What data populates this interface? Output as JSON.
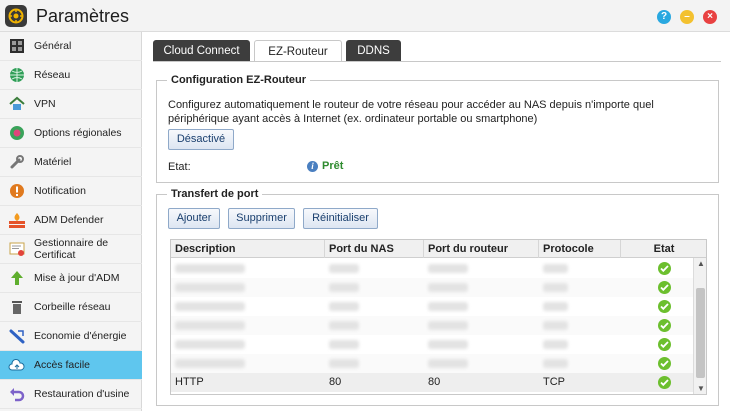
{
  "window": {
    "title": "Paramètres",
    "buttons": {
      "help": "?",
      "minimize": "–",
      "close": "×"
    }
  },
  "sidebar": {
    "items": [
      {
        "label": "Général",
        "icon": "grid-icon",
        "active": false
      },
      {
        "label": "Réseau",
        "icon": "globe-icon",
        "active": false
      },
      {
        "label": "VPN",
        "icon": "vpn-house-icon",
        "active": false
      },
      {
        "label": "Options régionales",
        "icon": "regional-clock-icon",
        "active": false
      },
      {
        "label": "Matériel",
        "icon": "wrench-icon",
        "active": false
      },
      {
        "label": "Notification",
        "icon": "alert-icon",
        "active": false
      },
      {
        "label": "ADM Defender",
        "icon": "firewall-icon",
        "active": false
      },
      {
        "label": "Gestionnaire de Certificat",
        "icon": "certificate-icon",
        "active": false
      },
      {
        "label": "Mise à jour d'ADM",
        "icon": "update-arrow-icon",
        "active": false
      },
      {
        "label": "Corbeille réseau",
        "icon": "trash-icon",
        "active": false
      },
      {
        "label": "Economie d'énergie",
        "icon": "energy-icon",
        "active": false
      },
      {
        "label": "Accès facile",
        "icon": "cloud-icon",
        "active": true
      },
      {
        "label": "Restauration d'usine",
        "icon": "restore-icon",
        "active": false
      }
    ]
  },
  "tabs": [
    {
      "label": "Cloud Connect",
      "active": false
    },
    {
      "label": "EZ-Routeur",
      "active": true
    },
    {
      "label": "DDNS",
      "active": false
    }
  ],
  "ez_config": {
    "legend": "Configuration EZ-Routeur",
    "description": "Configurez automatiquement le routeur de votre réseau pour accéder au NAS depuis n'importe quel périphérique ayant accès à Internet (ex. ordinateur portable ou smartphone)",
    "toggle_label": "Désactivé",
    "etat_label": "Etat:",
    "etat_value": "Prêt"
  },
  "port_forward": {
    "legend": "Transfert de port",
    "buttons": {
      "add": "Ajouter",
      "delete": "Supprimer",
      "reset": "Réinitialiser"
    },
    "columns": [
      "Description",
      "Port du NAS",
      "Port du routeur",
      "Protocole",
      "Etat"
    ],
    "rows": [
      {
        "description": "",
        "nas_port": "",
        "router_port": "",
        "protocol": "",
        "status": "ok",
        "blurred": true
      },
      {
        "description": "",
        "nas_port": "",
        "router_port": "",
        "protocol": "",
        "status": "ok",
        "blurred": true
      },
      {
        "description": "",
        "nas_port": "",
        "router_port": "",
        "protocol": "",
        "status": "ok",
        "blurred": true
      },
      {
        "description": "",
        "nas_port": "",
        "router_port": "",
        "protocol": "",
        "status": "ok",
        "blurred": true
      },
      {
        "description": "",
        "nas_port": "",
        "router_port": "",
        "protocol": "",
        "status": "ok",
        "blurred": true
      },
      {
        "description": "",
        "nas_port": "",
        "router_port": "",
        "protocol": "",
        "status": "ok",
        "blurred": true
      },
      {
        "description": "HTTP",
        "nas_port": "80",
        "router_port": "80",
        "protocol": "TCP",
        "status": "ok",
        "blurred": false
      }
    ]
  },
  "colors": {
    "active_sidebar": "#5fc6ee",
    "status_ok": "#6cbf2e",
    "ready_text": "#2e8b2e"
  }
}
